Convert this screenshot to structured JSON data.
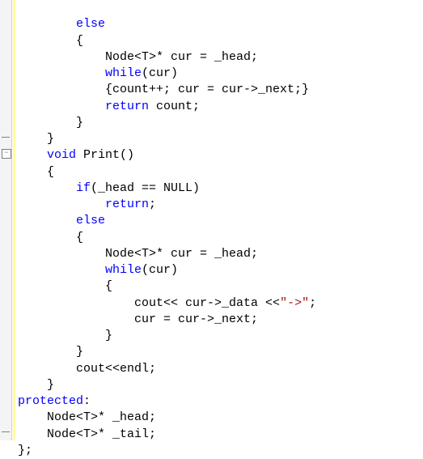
{
  "code": {
    "line1": "        else",
    "line2": "        {",
    "line3a": "            Node<T>* cur = _head;",
    "line4": "            while",
    "line4b": "(cur)",
    "line5a": "            {count++; cur = cur->_next;}",
    "line6": "            return",
    "line6b": " count;",
    "line7": "        }",
    "line8": "    }",
    "line9": "    void",
    "line9b": " Print()",
    "line10": "    {",
    "line11": "        if",
    "line11b": "(_head == NULL)",
    "line12": "            return",
    "line12b": ";",
    "line13": "        else",
    "line14": "        {",
    "line15a": "            Node<T>* cur = _head;",
    "line16": "            while",
    "line16b": "(cur)",
    "line17": "            {",
    "line18a": "                cout<< cur->_data <<",
    "line18b": "\"->\"",
    "line18c": ";",
    "line19a": "                cur = cur->_next;",
    "line20": "            }",
    "line21": "        }",
    "line22a": "        cout<<endl;",
    "line23": "    }",
    "line24": "protected",
    "line24b": ":",
    "line25a": "    Node<T>* _head;",
    "line26a": "    Node<T>* _tail;",
    "line27": "};"
  },
  "fold": {
    "minus": "−",
    "dash": ""
  }
}
